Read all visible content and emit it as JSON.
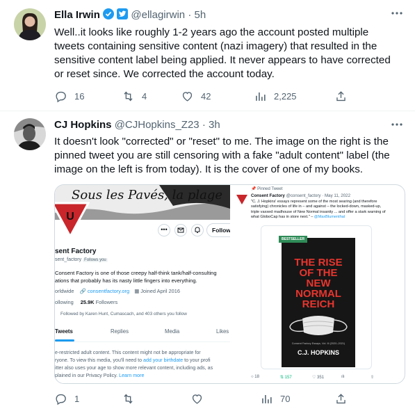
{
  "tweet1": {
    "name": "Ella Irwin",
    "handle": "@ellagirwin",
    "time": "· 5h",
    "text": "Well..it looks like roughly 1-2 years ago the account posted multiple tweets containing sensitive content (nazi imagery) that resulted in the sensitive content label being applied. It never appears to have corrected or reset since. We corrected the account today.",
    "replies": "16",
    "retweets": "4",
    "likes": "42",
    "views": "2,225"
  },
  "tweet2": {
    "name": "CJ Hopkins",
    "handle": "@CJHopkins_Z23",
    "time": "· 3h",
    "text": "It doesn't look \"corrected\" or \"reset\" to me. The image on the right is the pinned tweet you are still censoring with a fake \"adult content\" label (the image on the left is from today). It is the cover of one of my books.",
    "replies": "1",
    "retweets": "",
    "likes": "",
    "views": "70"
  },
  "left_shot": {
    "banner_text": "Sous les Pavés, la plage",
    "follow_label": "Followi",
    "profile_name": "sent Factory",
    "profile_handle": "sent_factory",
    "follows_you": "Follows you",
    "bio": "Consent Factory is one of those creepy half-think tank/half-consulting ations that probably has its nasty little fingers into everything.",
    "location": "orldwide",
    "website": "consentfactory.org",
    "joined": "Joined April 2016",
    "following_count": "ollowing",
    "followers_count": "25.9K",
    "followers_label": "Followers",
    "followed_by": "Followed by Karen Hunt, Cumascach, and 403 others you follow",
    "tabs": [
      "Tweets",
      "Replies",
      "Media",
      "Likes"
    ],
    "warning_line1": "e-restricted adult content. This content might not be appropriate for",
    "warning_line2a": "ryone. To view this media, you'll need to ",
    "warning_link1": "add your birthdate",
    "warning_line2b": " to your profi",
    "warning_line3": "itter also uses your age to show more relevant content, including ads, as",
    "warning_line4a": "plained in our Privacy Policy. ",
    "warning_link2": "Learn more"
  },
  "right_shot": {
    "pinned": "Pinned Tweet",
    "name": "Consent Factory",
    "handle": "@consent_factory · May 11, 2022",
    "quote": "\"C. J. Hopkins' essays represent some of the most searing (and therefore satisfying) chronicles of life in – and against – the locked-down, masked-up, triple vaxxed madhouse of New Normal insanity ... and offer a stark warning of what GloboCap has in store next.\" – ",
    "quote_link": "@MaxBlumenthal",
    "bestseller": "BESTSELLER",
    "book_title": [
      "THE RISE",
      "OF THE",
      "NEW",
      "NORMAL",
      "REICH"
    ],
    "book_subtitle": "Consent Factory Essays, Vol. III (2020–2021)",
    "book_author": "C.J. HOPKINS",
    "replies": "18",
    "retweets": "157",
    "likes": "351"
  },
  "colors": {
    "accent": "#1d9bf0",
    "muted": "#536471",
    "border": "#cfd9de",
    "book_red": "#e8352e",
    "book_bg": "#161616",
    "retweet_green": "#00ba7c"
  }
}
